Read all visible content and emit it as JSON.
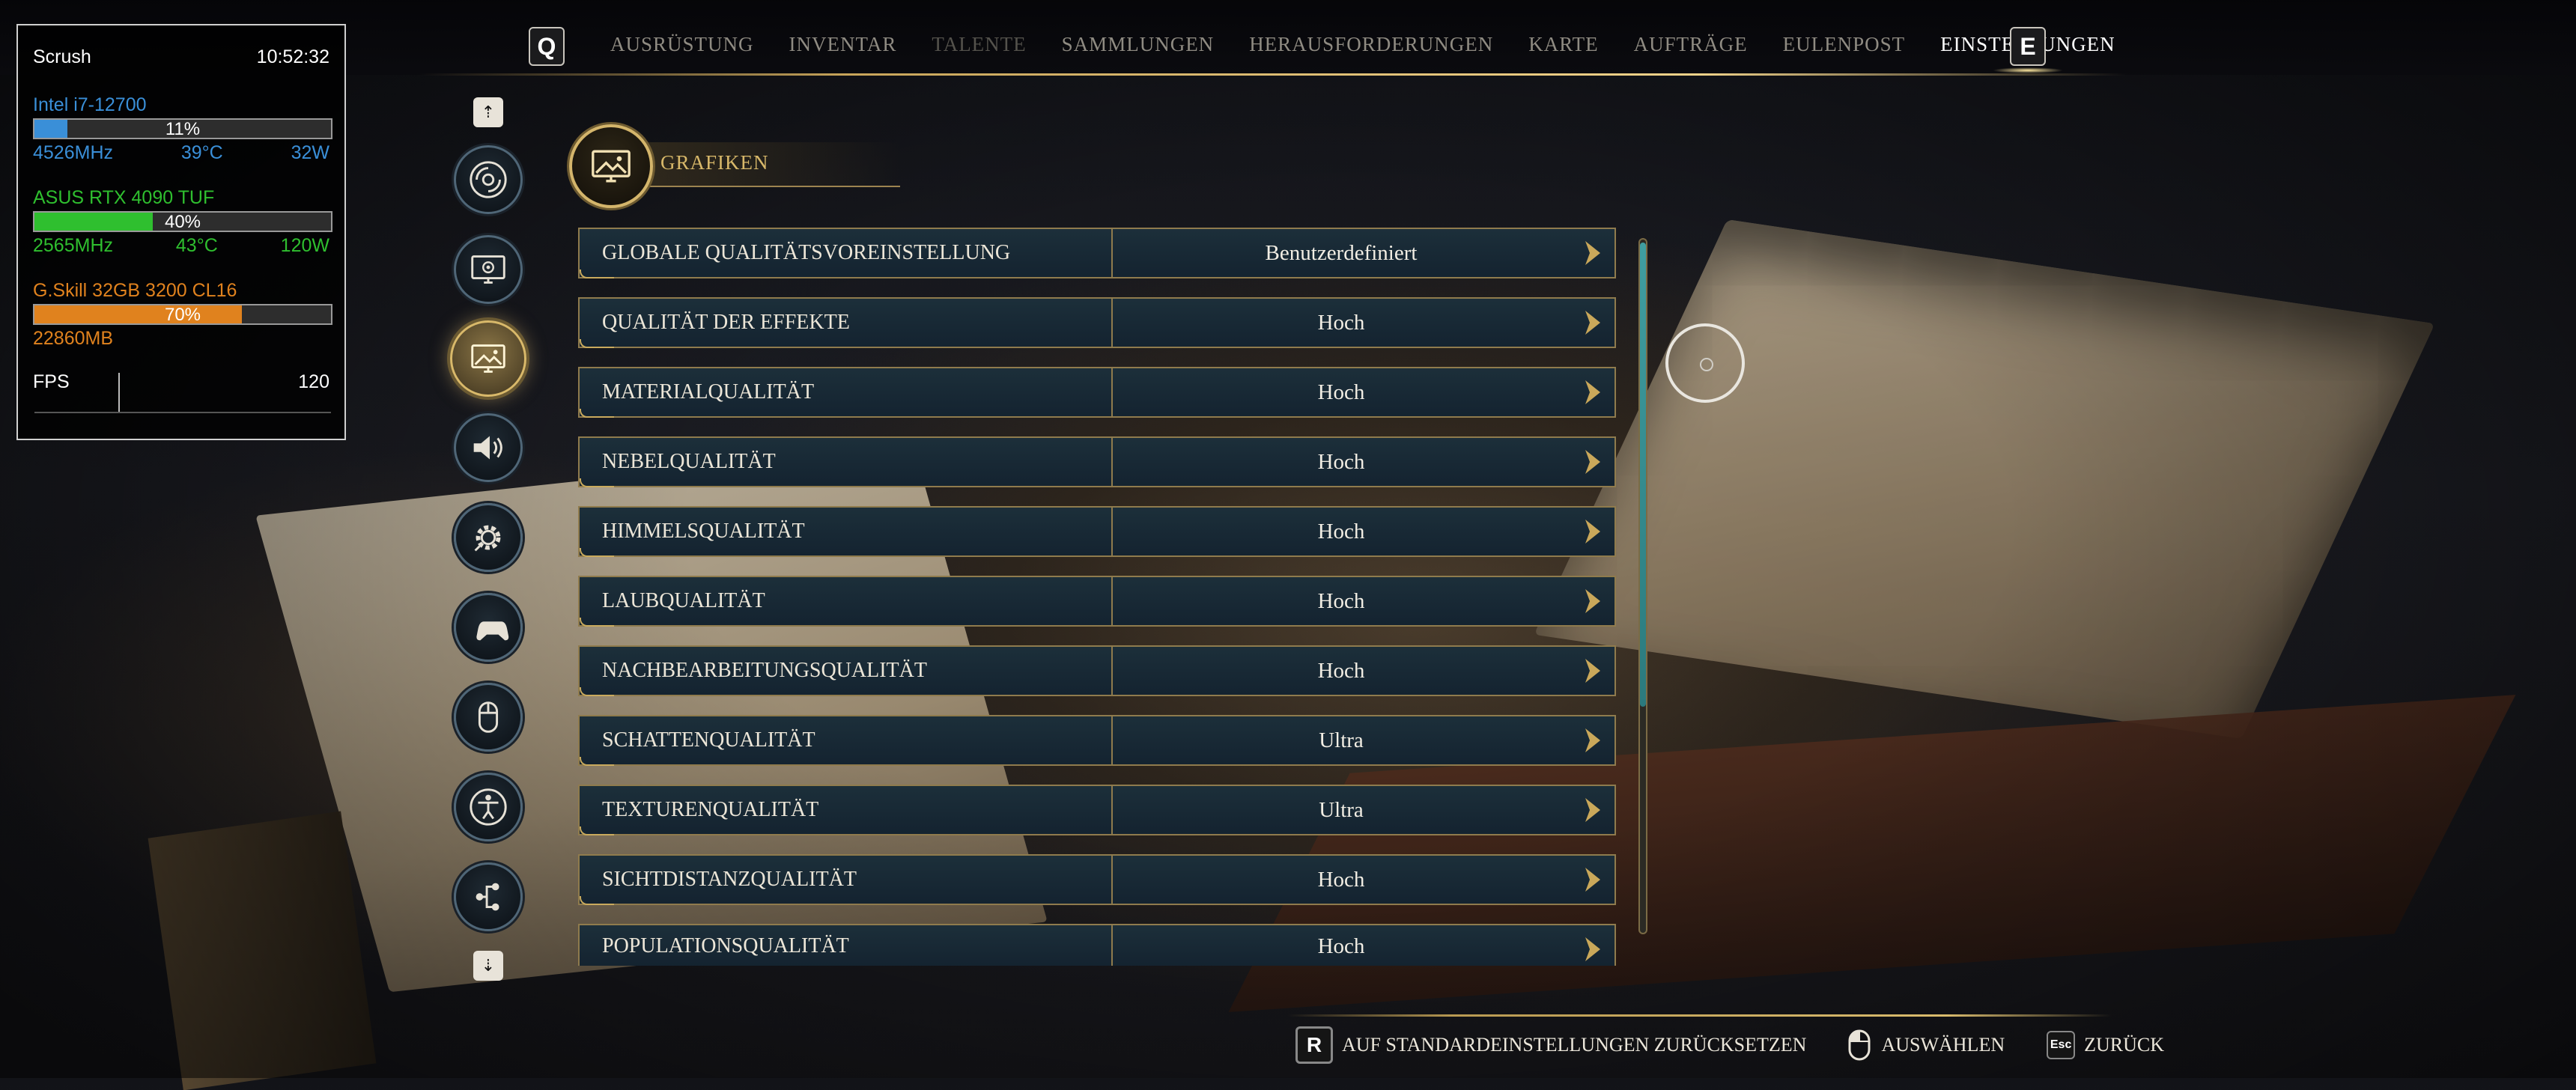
{
  "nav": {
    "left_key": "Q",
    "right_key": "E",
    "items": [
      {
        "label": "AUSRÜSTUNG",
        "state": "normal"
      },
      {
        "label": "INVENTAR",
        "state": "normal"
      },
      {
        "label": "TALENTE",
        "state": "disabled"
      },
      {
        "label": "SAMMLUNGEN",
        "state": "normal"
      },
      {
        "label": "HERAUSFORDERUNGEN",
        "state": "normal"
      },
      {
        "label": "KARTE",
        "state": "normal"
      },
      {
        "label": "AUFTRÄGE",
        "state": "normal"
      },
      {
        "label": "EULENPOST",
        "state": "normal"
      },
      {
        "label": "EINSTELLUNGEN",
        "state": "active"
      }
    ]
  },
  "hw_overlay": {
    "user": "Scrush",
    "time": "10:52:32",
    "cpu": {
      "name": "Intel i7-12700",
      "load_pct": 11,
      "load_text": "11%",
      "clock": "4526MHz",
      "temp": "39°C",
      "power": "32W",
      "color": "#3a8fd8"
    },
    "gpu": {
      "name": "ASUS RTX 4090 TUF",
      "load_pct": 40,
      "load_text": "40%",
      "clock": "2565MHz",
      "temp": "43°C",
      "power": "120W",
      "color": "#2fbf2f"
    },
    "ram": {
      "name": "G.Skill 32GB 3200 CL16",
      "load_pct": 70,
      "load_text": "70%",
      "used": "22860MB",
      "color": "#e0821e"
    },
    "fps": {
      "label": "FPS",
      "value": "120"
    }
  },
  "sidebar": {
    "up_arrow": "⇡",
    "down_arrow": "⇣",
    "icons": [
      {
        "name": "disc-icon",
        "active": false
      },
      {
        "name": "monitor-settings-icon",
        "active": false
      },
      {
        "name": "graphics-picture-icon",
        "active": true
      },
      {
        "name": "speaker-icon",
        "active": false
      },
      {
        "name": "gear-icon",
        "active": false
      },
      {
        "name": "gamepad-icon",
        "active": false
      },
      {
        "name": "mouse-icon",
        "active": false
      },
      {
        "name": "accessibility-icon",
        "active": false
      },
      {
        "name": "network-icon",
        "active": false
      }
    ]
  },
  "section": {
    "title": "GRAFIKEN"
  },
  "settings": [
    {
      "label": "GLOBALE QUALITÄTSVOREINSTELLUNG",
      "value": "Benutzerdefiniert"
    },
    {
      "label": "QUALITÄT DER EFFEKTE",
      "value": "Hoch"
    },
    {
      "label": "MATERIALQUALITÄT",
      "value": "Hoch"
    },
    {
      "label": "NEBELQUALITÄT",
      "value": "Hoch"
    },
    {
      "label": "HIMMELSQUALITÄT",
      "value": "Hoch"
    },
    {
      "label": "LAUBQUALITÄT",
      "value": "Hoch"
    },
    {
      "label": "NACHBEARBEITUNGSQUALITÄT",
      "value": "Hoch"
    },
    {
      "label": "SCHATTENQUALITÄT",
      "value": "Ultra"
    },
    {
      "label": "TEXTURENQUALITÄT",
      "value": "Ultra"
    },
    {
      "label": "SICHTDISTANZQUALITÄT",
      "value": "Hoch"
    },
    {
      "label": "POPULATIONSQUALITÄT",
      "value": "Hoch"
    }
  ],
  "bottom": {
    "reset_key": "R",
    "reset_label": "AUF STANDARDEINSTELLUNGEN ZURÜCKSETZEN",
    "select_label": "AUSWÄHLEN",
    "back_key": "Esc",
    "back_label": "ZURÜCK"
  },
  "colors": {
    "accent_gold": "#c9aa5d",
    "row_bg": "#182a35",
    "scroll_thumb": "#3f9ea1"
  }
}
